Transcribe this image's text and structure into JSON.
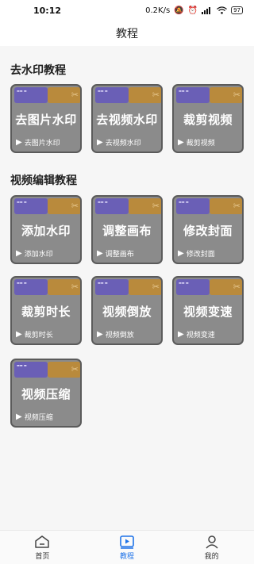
{
  "status_bar": {
    "time": "10:12",
    "net_speed": "0.2K/s",
    "battery": "97"
  },
  "header": {
    "title": "教程"
  },
  "sections": [
    {
      "title": "去水印教程"
    },
    {
      "title": "视频编辑教程"
    }
  ],
  "cards": [
    {
      "big": "去图片水印",
      "label": "去图片水印"
    },
    {
      "big": "去视频水印",
      "label": "去视频水印"
    },
    {
      "big": "裁剪视频",
      "label": "裁剪视频"
    },
    {
      "big": "添加水印",
      "label": "添加水印"
    },
    {
      "big": "调整画布",
      "label": "调整画布"
    },
    {
      "big": "修改封面",
      "label": "修改封面"
    },
    {
      "big": "裁剪时长",
      "label": "裁剪时长"
    },
    {
      "big": "视频倒放",
      "label": "视频倒放"
    },
    {
      "big": "视频变速",
      "label": "视频变速"
    },
    {
      "big": "视频压缩",
      "label": "视频压缩"
    }
  ],
  "bottom_nav": [
    {
      "label": "首页",
      "icon": "home-icon",
      "active": false
    },
    {
      "label": "教程",
      "icon": "play-tutorial-icon",
      "active": true,
      "color": "#1f73e8"
    },
    {
      "label": "我的",
      "icon": "user-icon",
      "active": false
    }
  ]
}
